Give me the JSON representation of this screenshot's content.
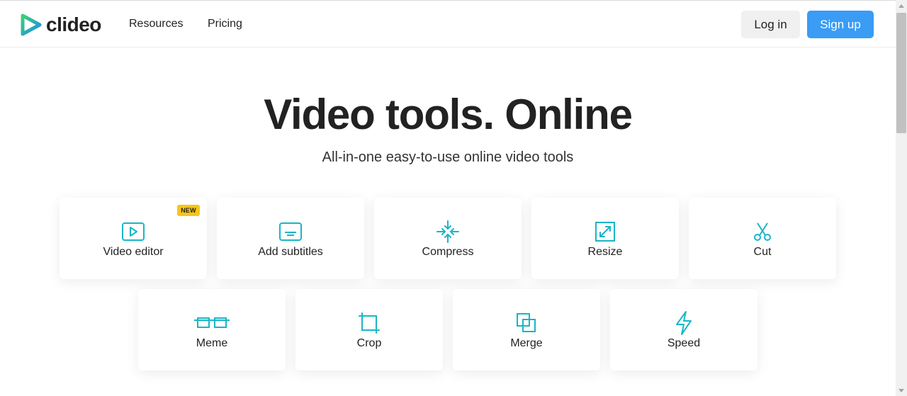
{
  "brand": {
    "name": "clideo"
  },
  "nav": {
    "items": [
      "Resources",
      "Pricing"
    ]
  },
  "auth": {
    "login": "Log in",
    "signup": "Sign up"
  },
  "hero": {
    "title": "Video tools. Online",
    "subtitle": "All-in-one easy-to-use online video tools"
  },
  "tools": [
    {
      "label": "Video editor",
      "icon": "play-icon",
      "badge": "NEW"
    },
    {
      "label": "Add subtitles",
      "icon": "subtitles-icon"
    },
    {
      "label": "Compress",
      "icon": "compress-icon"
    },
    {
      "label": "Resize",
      "icon": "resize-icon"
    },
    {
      "label": "Cut",
      "icon": "scissors-icon"
    },
    {
      "label": "Meme",
      "icon": "meme-icon"
    },
    {
      "label": "Crop",
      "icon": "crop-icon"
    },
    {
      "label": "Merge",
      "icon": "merge-icon"
    },
    {
      "label": "Speed",
      "icon": "lightning-icon"
    }
  ],
  "colors": {
    "accent": "#1ab5c7",
    "signup": "#3a9cf5",
    "badge": "#f7c619"
  }
}
